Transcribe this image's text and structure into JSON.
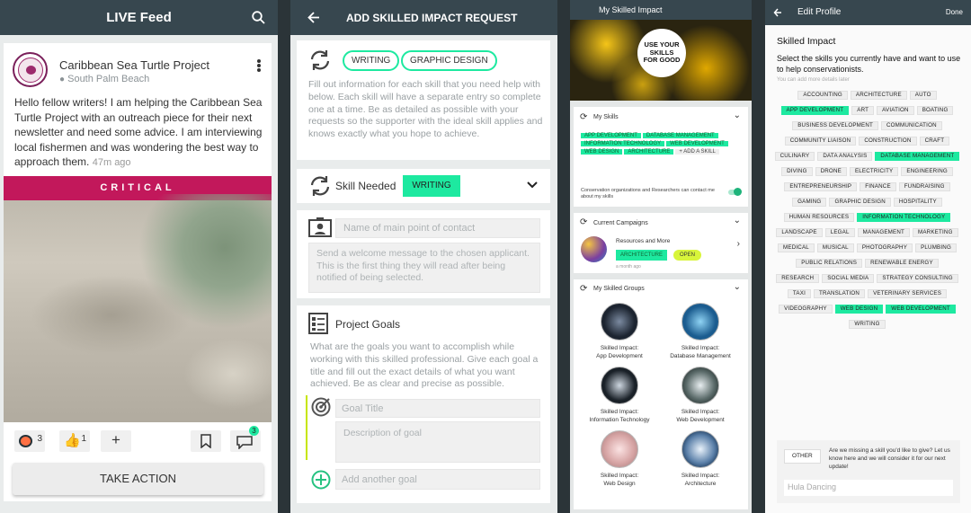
{
  "feed": {
    "title": "LIVE Feed",
    "org": "Caribbean Sea Turtle Project",
    "location": "South Palm Beach",
    "post": "Hello fellow writers! I am helping the Caribbean Sea Turtle Project with an outreach piece for their next newsletter and need some advice. I am interviewing local fishermen and was wondering the best way to approach them.",
    "time": "47m ago",
    "banner": "CRITICAL",
    "turtle_count": "3",
    "like_count": "1",
    "comment_count": "3",
    "action": "TAKE ACTION"
  },
  "request": {
    "title": "ADD SKILLED IMPACT REQUEST",
    "chips": [
      "WRITING",
      "GRAPHIC DESIGN"
    ],
    "intro": "Fill out information for each skill that you need help with below. Each skill will have a separate entry so complete one at a time. Be as detailed as possible with your requests so the supporter with the ideal skill applies and knows exactly what you hope to achieve.",
    "skill_needed_label": "Skill Needed",
    "skill_needed_value": "WRITING",
    "contact_placeholder": "Name of main point of contact",
    "welcome_placeholder": "Send a welcome message to the chosen applicant. This is the first thing they will read after being notified of being selected.",
    "goals_title": "Project Goals",
    "goals_desc": "What are the goals you want to accomplish while working with this skilled professional. Give each goal a title and fill out the exact details of what you want achieved. Be as clear and precise as possible.",
    "goal_title_placeholder": "Goal Title",
    "goal_desc_placeholder": "Description of goal",
    "add_goal_placeholder": "Add another goal"
  },
  "profile": {
    "title": "My Skilled Impact",
    "hero_text": "USE YOUR SKILLS FOR GOOD",
    "my_skills_label": "My Skills",
    "skills": [
      "APP DEVELOPMENT",
      "DATABASE MANAGEMENT",
      "INFORMATION TECHNOLOGY",
      "WEB DEVELOPMENT",
      "WEB DESIGN",
      "ARCHITECTURE"
    ],
    "add_skill": "ADD A SKILL",
    "contact_toggle_text": "Conservation organizations and Researchers can contact me about my skills",
    "campaigns_label": "Current Campaigns",
    "campaign_name": "Resources and More",
    "campaign_tag": "ARCHITECTURE",
    "campaign_status": "OPEN",
    "campaign_time": "a month ago",
    "groups_label": "My Skilled Groups",
    "groups": [
      {
        "line1": "Skilled Impact:",
        "line2": "App Development"
      },
      {
        "line1": "Skilled Impact:",
        "line2": "Database Management"
      },
      {
        "line1": "Skilled Impact:",
        "line2": "Information Technology"
      },
      {
        "line1": "Skilled Impact:",
        "line2": "Web Development"
      },
      {
        "line1": "Skilled Impact:",
        "line2": "Web Design"
      },
      {
        "line1": "Skilled Impact:",
        "line2": "Architecture"
      }
    ]
  },
  "edit": {
    "title": "Edit Profile",
    "done": "Done",
    "heading": "Skilled Impact",
    "subheading": "Select the skills you currently have and want to use to help conservationists.",
    "hint": "You can add more details later",
    "skills": [
      {
        "label": "ACCOUNTING",
        "on": false
      },
      {
        "label": "ARCHITECTURE",
        "on": false
      },
      {
        "label": "AUTO",
        "on": false
      },
      {
        "label": "APP DEVELOPMENT",
        "on": true
      },
      {
        "label": "ART",
        "on": false
      },
      {
        "label": "AVIATION",
        "on": false
      },
      {
        "label": "BOATING",
        "on": false
      },
      {
        "label": "BUSINESS DEVELOPMENT",
        "on": false
      },
      {
        "label": "COMMUNICATION",
        "on": false
      },
      {
        "label": "COMMUNITY LIAISON",
        "on": false
      },
      {
        "label": "CONSTRUCTION",
        "on": false
      },
      {
        "label": "CRAFT",
        "on": false
      },
      {
        "label": "CULINARY",
        "on": false
      },
      {
        "label": "DATA ANALYSIS",
        "on": false
      },
      {
        "label": "DATABASE MANAGEMENT",
        "on": true
      },
      {
        "label": "DIVING",
        "on": false
      },
      {
        "label": "DRONE",
        "on": false
      },
      {
        "label": "ELECTRICITY",
        "on": false
      },
      {
        "label": "ENGINEERING",
        "on": false
      },
      {
        "label": "ENTREPRENEURSHIP",
        "on": false
      },
      {
        "label": "FINANCE",
        "on": false
      },
      {
        "label": "FUNDRAISING",
        "on": false
      },
      {
        "label": "GAMING",
        "on": false
      },
      {
        "label": "GRAPHIC DESIGN",
        "on": false
      },
      {
        "label": "HOSPITALITY",
        "on": false
      },
      {
        "label": "HUMAN RESOURCES",
        "on": false
      },
      {
        "label": "INFORMATION TECHNOLOGY",
        "on": true
      },
      {
        "label": "LANDSCAPE",
        "on": false
      },
      {
        "label": "LEGAL",
        "on": false
      },
      {
        "label": "MANAGEMENT",
        "on": false
      },
      {
        "label": "MARKETING",
        "on": false
      },
      {
        "label": "MEDICAL",
        "on": false
      },
      {
        "label": "MUSICAL",
        "on": false
      },
      {
        "label": "PHOTOGRAPHY",
        "on": false
      },
      {
        "label": "PLUMBING",
        "on": false
      },
      {
        "label": "PUBLIC RELATIONS",
        "on": false
      },
      {
        "label": "RENEWABLE ENERGY",
        "on": false
      },
      {
        "label": "RESEARCH",
        "on": false
      },
      {
        "label": "SOCIAL MEDIA",
        "on": false
      },
      {
        "label": "STRATEGY CONSULTING",
        "on": false
      },
      {
        "label": "TAXI",
        "on": false
      },
      {
        "label": "TRANSLATION",
        "on": false
      },
      {
        "label": "VETERINARY SERVICES",
        "on": false
      },
      {
        "label": "VIDEOGRAPHY",
        "on": false
      },
      {
        "label": "WEB DESIGN",
        "on": true
      },
      {
        "label": "WEB DEVELOPMENT",
        "on": true
      },
      {
        "label": "WRITING",
        "on": false
      }
    ],
    "other": "OTHER",
    "other_text": "Are we missing a skill you'd like to give? Let us know here and we will consider it for our next update!",
    "other_value": "Hula Dancing"
  },
  "colors": {
    "accent": "#1de9a0",
    "header": "#37474f",
    "critical": "#c2185b"
  }
}
